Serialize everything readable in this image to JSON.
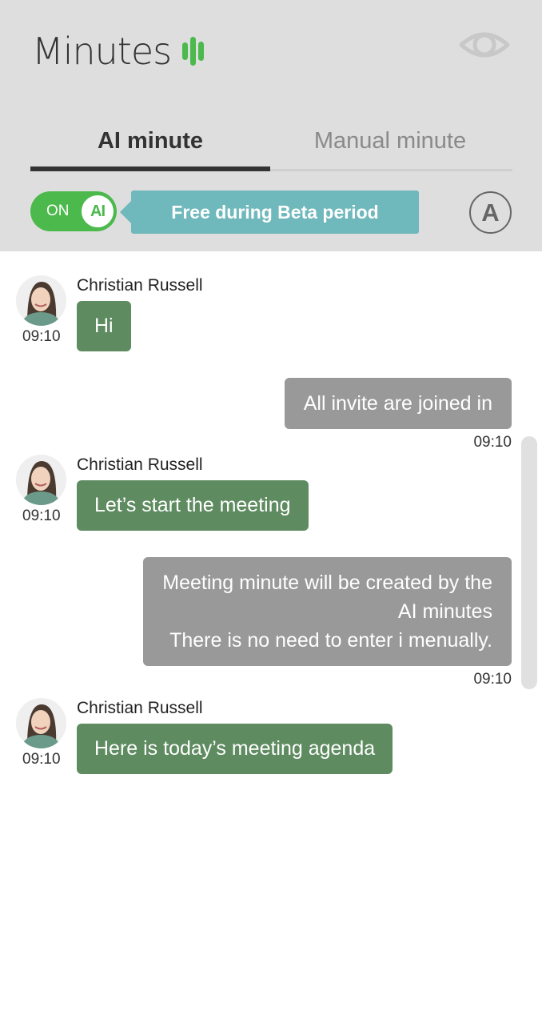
{
  "header": {
    "title": "Minutes",
    "logo_icon": "sound-bars-icon",
    "eye_icon": "eye-icon"
  },
  "tabs": [
    {
      "label": "AI minute",
      "active": true
    },
    {
      "label": "Manual minute",
      "active": false
    }
  ],
  "ai_toggle": {
    "state_label": "ON",
    "knob_label": "AI",
    "on": true
  },
  "beta_banner": "Free during Beta period",
  "font_button": {
    "label": "A"
  },
  "colors": {
    "header_bg": "#dedede",
    "accent_green": "#4cb94c",
    "incoming_bubble": "#5e8b60",
    "outgoing_bubble": "#999999",
    "beta_banner": "#6fb8bb"
  },
  "messages": [
    {
      "direction": "in",
      "sender": "Christian Russell",
      "time": "09:10",
      "text": "Hi"
    },
    {
      "direction": "out",
      "time": "09:10",
      "lines": [
        "All invite are joined in"
      ]
    },
    {
      "direction": "in",
      "sender": "Christian Russell",
      "time": "09:10",
      "text": "Let’s start the meeting"
    },
    {
      "direction": "out",
      "time": "09:10",
      "lines": [
        "Meeting minute will be created by the",
        "AI minutes",
        "There is no need to enter i menually."
      ]
    },
    {
      "direction": "in",
      "sender": "Christian Russell",
      "time": "09:10",
      "text": "Here is today’s meeting agenda"
    }
  ]
}
